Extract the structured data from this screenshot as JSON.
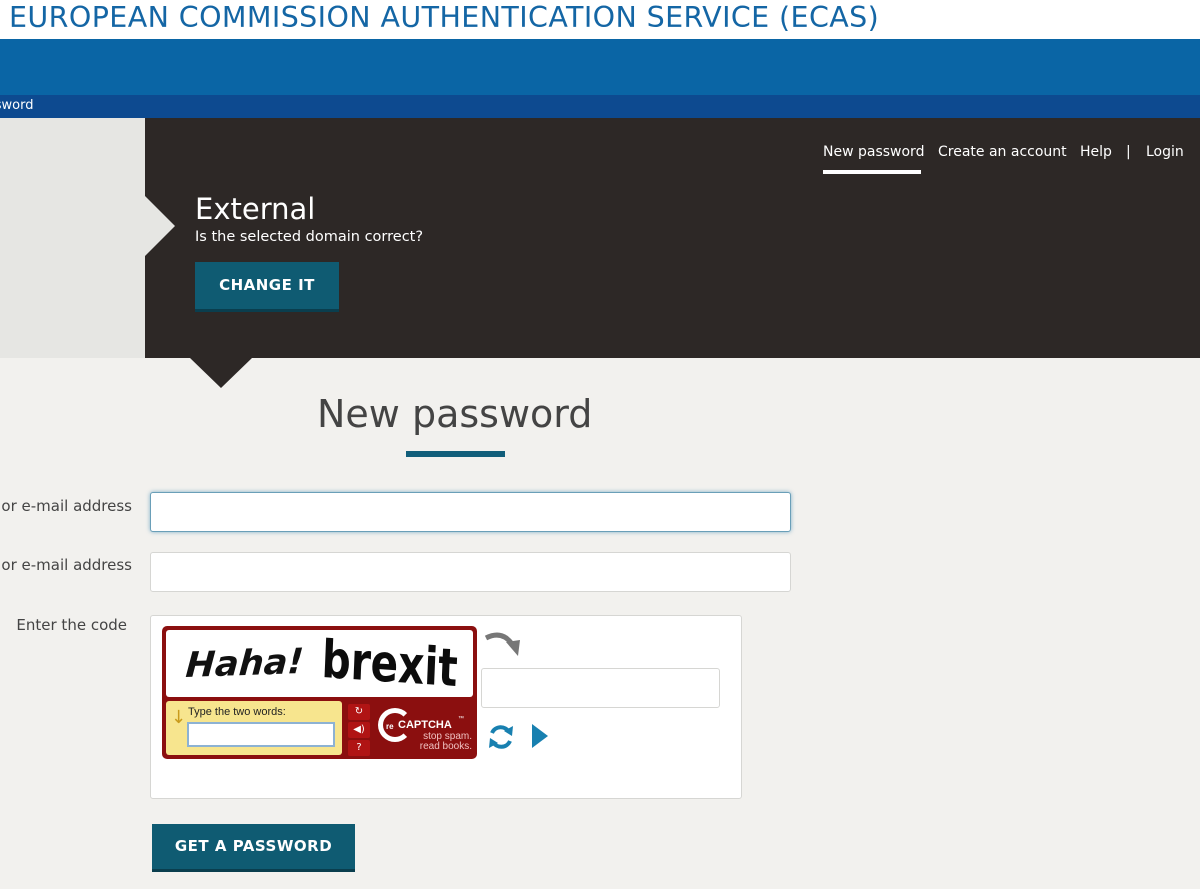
{
  "header": {
    "title": "EUROPEAN COMMISSION AUTHENTICATION SERVICE (ECAS)",
    "breadcrumb": "ssword"
  },
  "topnav": {
    "new_password": "New password",
    "create_account": "Create an account",
    "help": "Help",
    "separator": "|",
    "login": "Login"
  },
  "domain": {
    "name": "External",
    "question": "Is the selected domain correct?",
    "change_button": "CHANGE IT"
  },
  "form": {
    "title": "New password",
    "field1_label": "or e-mail address",
    "field1_value": "",
    "field2_label": "or e-mail address",
    "field2_value": "",
    "code_label": "Enter the code",
    "submit_button": "GET A PASSWORD"
  },
  "captcha": {
    "word1": "Haha!",
    "word2": "brexit",
    "prompt": "Type the two words:",
    "brand_prefix": "re",
    "brand": "CAPTCHA",
    "trademark": "™",
    "slogan_line1": "stop spam.",
    "slogan_line2": "read books.",
    "answer_value": ""
  },
  "colors": {
    "brand_blue": "#1466a5",
    "band_blue": "#0a65a5",
    "crumb_blue": "#0d4a90",
    "hero_dark": "#2d2826",
    "button_teal": "#0f5b72",
    "captcha_red": "#8b0f0f"
  }
}
